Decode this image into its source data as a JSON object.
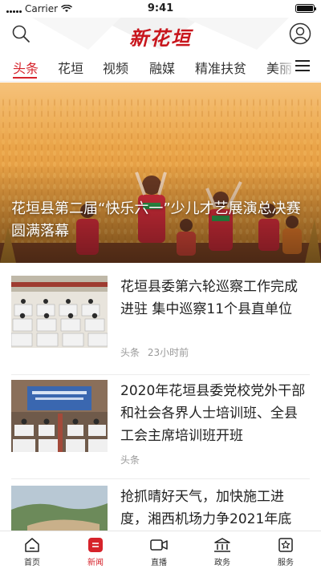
{
  "status_bar": {
    "carrier": "Carrier",
    "time": "9:41"
  },
  "header": {
    "logo_text": "新花垣",
    "search_icon": "search-icon",
    "profile_icon": "user-profile-icon"
  },
  "tabs": [
    {
      "label": "头条",
      "active": true
    },
    {
      "label": "花垣"
    },
    {
      "label": "视频"
    },
    {
      "label": "融媒"
    },
    {
      "label": "精准扶贫"
    },
    {
      "label": "美丽"
    }
  ],
  "menu_icon": "menu-icon",
  "hero": {
    "title": "花垣县第二届“快乐六一”少儿才艺展演总决赛圆满落幕"
  },
  "news": [
    {
      "title": "花垣县委第六轮巡察工作完成进驻 集中巡察11个县直单位",
      "source": "头条",
      "time": "23小时前"
    },
    {
      "title": "2020年花垣县委党校党外干部和社会各界人士培训班、全县工会主席培训班开班",
      "source": "头条",
      "time": ""
    },
    {
      "title": "抢抓晴好天气，加快施工进度，湘西机场力争2021年底",
      "source": "",
      "time": ""
    }
  ],
  "bottom_nav": [
    {
      "label": "首页",
      "icon": "home-icon"
    },
    {
      "label": "新闻",
      "icon": "news-icon",
      "active": true
    },
    {
      "label": "直播",
      "icon": "live-icon"
    },
    {
      "label": "政务",
      "icon": "government-icon"
    },
    {
      "label": "服务",
      "icon": "service-icon"
    }
  ],
  "colors": {
    "accent": "#d6232b",
    "logo": "#c8161d"
  }
}
